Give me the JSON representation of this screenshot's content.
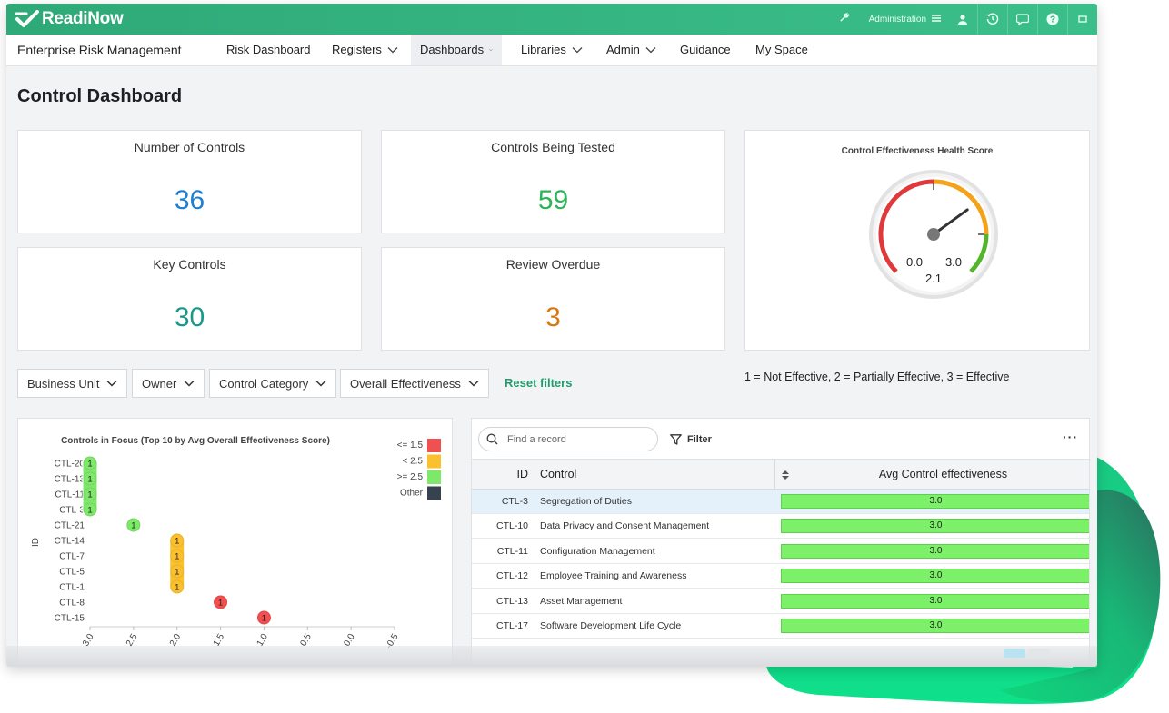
{
  "brand": {
    "name": "ReadiNow"
  },
  "topbar": {
    "admin_label": "Administration"
  },
  "nav": {
    "app_name": "Enterprise Risk Management",
    "items": [
      {
        "label": "Risk Dashboard",
        "dropdown": false
      },
      {
        "label": "Registers",
        "dropdown": true
      },
      {
        "label": "Dashboards",
        "dropdown": true,
        "active": true
      },
      {
        "label": "Libraries",
        "dropdown": true
      },
      {
        "label": "Admin",
        "dropdown": true
      },
      {
        "label": "Guidance",
        "dropdown": false
      },
      {
        "label": "My Space",
        "dropdown": false
      }
    ]
  },
  "page": {
    "title": "Control Dashboard"
  },
  "kpis": [
    {
      "label": "Number of Controls",
      "value": "36",
      "color": "#1f7fd1"
    },
    {
      "label": "Controls Being Tested",
      "value": "59",
      "color": "#2db45a"
    },
    {
      "label": "Key Controls",
      "value": "30",
      "color": "#16998a"
    },
    {
      "label": "Review Overdue",
      "value": "3",
      "color": "#d8770f"
    }
  ],
  "gauge": {
    "title": "Control Effectiveness Health Score",
    "min": 0.0,
    "max": 3.0,
    "value": 2.1,
    "min_label": "0.0",
    "max_label": "3.0",
    "value_label": "2.1",
    "bands": [
      {
        "from": 0.0,
        "to": 1.5,
        "color": "#e0393b"
      },
      {
        "from": 1.5,
        "to": 2.5,
        "color": "#f5a21b"
      },
      {
        "from": 2.5,
        "to": 3.0,
        "color": "#52b52a"
      }
    ]
  },
  "filters": {
    "items": [
      "Business Unit",
      "Owner",
      "Control Category",
      "Overall Effectiveness"
    ],
    "reset_label": "Reset filters",
    "legend_text": "1 = Not Effective, 2 = Partially Effective, 3 = Effective"
  },
  "chart_data": {
    "type": "scatter",
    "title": "Controls in Focus (Top 10 by Avg Overall Effectiveness Score)",
    "xlabel": "",
    "ylabel": "ID",
    "xlim": [
      3.0,
      -0.5
    ],
    "x_ticks": [
      "3.0",
      "2.5",
      "2.0",
      "1.5",
      "1.0",
      "0.5",
      "0.0",
      "-0.5"
    ],
    "categories": [
      "CTL-20",
      "CTL-13",
      "CTL-11",
      "CTL-3",
      "CTL-21",
      "CTL-14",
      "CTL-7",
      "CTL-5",
      "CTL-1",
      "CTL-8",
      "CTL-15"
    ],
    "legend": [
      {
        "label": "<= 1.5",
        "color": "#f05050"
      },
      {
        "label": "< 2.5",
        "color": "#fbc02d"
      },
      {
        "label": ">= 2.5",
        "color": "#7de86a"
      },
      {
        "label": "Other",
        "color": "#37424f"
      }
    ],
    "points": [
      {
        "id": "CTL-20",
        "x": 3.0,
        "label": "1",
        "color": "#7de86a"
      },
      {
        "id": "CTL-13",
        "x": 3.0,
        "label": "1",
        "color": "#7de86a"
      },
      {
        "id": "CTL-11",
        "x": 3.0,
        "label": "1",
        "color": "#7de86a"
      },
      {
        "id": "CTL-3",
        "x": 3.0,
        "label": "1",
        "color": "#7de86a"
      },
      {
        "id": "CTL-21",
        "x": 2.5,
        "label": "1",
        "color": "#7de86a"
      },
      {
        "id": "CTL-14",
        "x": 2.0,
        "label": "1",
        "color": "#fbc02d"
      },
      {
        "id": "CTL-7",
        "x": 2.0,
        "label": "1",
        "color": "#fbc02d"
      },
      {
        "id": "CTL-5",
        "x": 2.0,
        "label": "1",
        "color": "#fbc02d"
      },
      {
        "id": "CTL-1",
        "x": 2.0,
        "label": "1",
        "color": "#fbc02d"
      },
      {
        "id": "CTL-8",
        "x": 1.5,
        "label": "1",
        "color": "#f05050"
      },
      {
        "id": "CTL-15",
        "x": 1.0,
        "label": "1",
        "color": "#f05050"
      }
    ]
  },
  "grid": {
    "search_placeholder": "Find a record",
    "filter_label": "Filter",
    "more_label": "···",
    "columns": {
      "id": "ID",
      "control": "Control",
      "avg": "Avg Control effectiveness"
    },
    "rows": [
      {
        "id": "CTL-3",
        "control": "Segregation of Duties",
        "avg": "3.0",
        "selected": true
      },
      {
        "id": "CTL-10",
        "control": "Data Privacy and Consent Management",
        "avg": "3.0"
      },
      {
        "id": "CTL-11",
        "control": "Configuration Management",
        "avg": "3.0"
      },
      {
        "id": "CTL-12",
        "control": "Employee Training and Awareness",
        "avg": "3.0"
      },
      {
        "id": "CTL-13",
        "control": "Asset Management",
        "avg": "3.0"
      },
      {
        "id": "CTL-17",
        "control": "Software Development Life Cycle",
        "avg": "3.0"
      }
    ]
  }
}
